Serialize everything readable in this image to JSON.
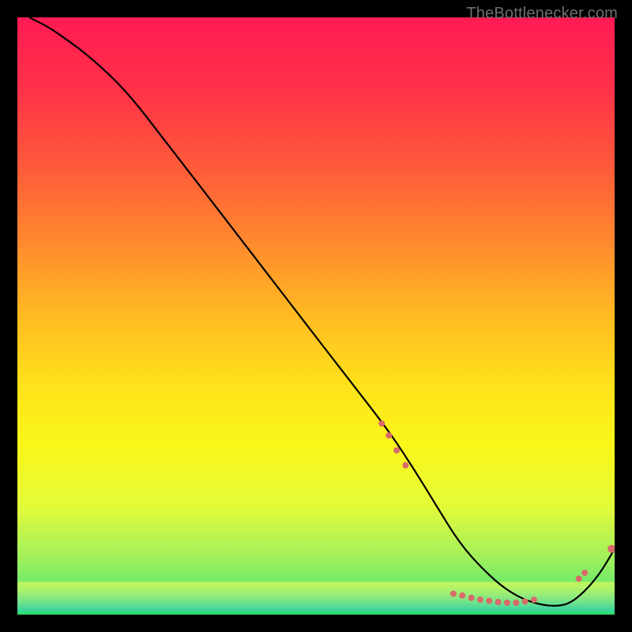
{
  "watermark_text": "TheBottlenecker.com",
  "gradient": {
    "stops": [
      {
        "offset": 0.0,
        "color": "#ff1b54"
      },
      {
        "offset": 0.12,
        "color": "#ff3148"
      },
      {
        "offset": 0.25,
        "color": "#ff5a3a"
      },
      {
        "offset": 0.38,
        "color": "#ff8b2d"
      },
      {
        "offset": 0.5,
        "color": "#ffbb22"
      },
      {
        "offset": 0.62,
        "color": "#ffe31a"
      },
      {
        "offset": 0.72,
        "color": "#f9f71a"
      },
      {
        "offset": 0.82,
        "color": "#e3fa3a"
      },
      {
        "offset": 0.91,
        "color": "#9cf05e"
      },
      {
        "offset": 1.0,
        "color": "#33e27a"
      }
    ]
  },
  "marker_color": "#d86a6a",
  "curve_color": "#000000",
  "chart_data": {
    "type": "line",
    "title": "",
    "xlabel": "",
    "ylabel": "",
    "xlim": [
      0,
      100
    ],
    "ylim": [
      0,
      100
    ],
    "series": [
      {
        "name": "curve",
        "x": [
          2,
          5,
          8,
          12,
          18,
          25,
          35,
          45,
          55,
          62,
          66,
          70,
          74,
          78,
          82,
          86,
          90,
          93,
          97,
          100
        ],
        "y": [
          100,
          98.5,
          96.5,
          93.5,
          88,
          79,
          66,
          53,
          40,
          31,
          25,
          18.5,
          12,
          7.5,
          4,
          2,
          1.3,
          2,
          6,
          11
        ]
      }
    ],
    "markers": [
      {
        "x": 61.0,
        "y": 32.0,
        "r": 4
      },
      {
        "x": 62.2,
        "y": 30.0,
        "r": 4
      },
      {
        "x": 63.5,
        "y": 27.5,
        "r": 4
      },
      {
        "x": 65.0,
        "y": 25.0,
        "r": 4
      },
      {
        "x": 73.0,
        "y": 3.5,
        "r": 4
      },
      {
        "x": 74.5,
        "y": 3.2,
        "r": 4
      },
      {
        "x": 76.0,
        "y": 2.8,
        "r": 4
      },
      {
        "x": 77.5,
        "y": 2.5,
        "r": 4
      },
      {
        "x": 79.0,
        "y": 2.3,
        "r": 4
      },
      {
        "x": 80.5,
        "y": 2.1,
        "r": 4
      },
      {
        "x": 82.0,
        "y": 2.0,
        "r": 4
      },
      {
        "x": 83.5,
        "y": 2.0,
        "r": 4
      },
      {
        "x": 85.0,
        "y": 2.2,
        "r": 4
      },
      {
        "x": 86.5,
        "y": 2.5,
        "r": 4
      },
      {
        "x": 94.0,
        "y": 6.0,
        "r": 4
      },
      {
        "x": 95.0,
        "y": 7.0,
        "r": 4
      },
      {
        "x": 99.5,
        "y": 11.0,
        "r": 5
      }
    ]
  }
}
